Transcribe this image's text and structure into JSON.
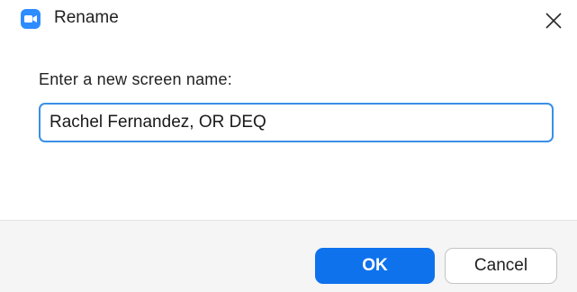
{
  "dialog": {
    "title": "Rename",
    "app_icon": "zoom-camera-icon",
    "close_icon": "close-icon",
    "prompt": "Enter a new screen name:",
    "input_value": "Rachel Fernandez, OR DEQ",
    "ok_label": "OK",
    "cancel_label": "Cancel"
  },
  "colors": {
    "accent": "#0e72ed",
    "app_icon": "#2d8cff",
    "input_border": "#3a8fe8",
    "footer_bg": "#f5f5f5"
  }
}
